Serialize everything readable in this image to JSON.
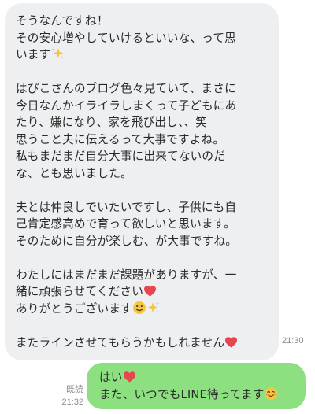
{
  "incoming": {
    "paragraphs": [
      {
        "lines": [
          {
            "text": "そうなんですね！"
          },
          {
            "text": "その安心増やしていけるといいな、って思"
          },
          {
            "text": "います",
            "icon": "sparkles-icon"
          }
        ]
      },
      {
        "lines": [
          {
            "text": "はぴこさんのブログ色々見ていて、まさに"
          },
          {
            "text": "今日なんかイライラしまくって子どもにあ"
          },
          {
            "text": "たり、嫌になり、家を飛び出し、、笑"
          },
          {
            "text": "思うこと夫に伝えるって大事ですよね。"
          },
          {
            "text": "私もまだまだ自分大事に出来てないのだ"
          },
          {
            "text": "な、とも思いました。"
          }
        ]
      },
      {
        "lines": [
          {
            "text": "夫とは仲良しでいたいですし、子供にも自"
          },
          {
            "text": "己肯定感高めで育って欲しいと思います。"
          },
          {
            "text": "そのために自分が楽しむ、が大事ですね。"
          }
        ]
      },
      {
        "lines": [
          {
            "text": "わたしにはまだまだ課題がありますが、一"
          },
          {
            "text": "緒に頑張らせてください",
            "icon": "heart-icon"
          },
          {
            "text": "ありがとうございます",
            "icon": "smiley-sparkles-icon"
          }
        ]
      },
      {
        "lines": [
          {
            "text": "またラインさせてもらうかもしれません",
            "icon": "heart-icon"
          }
        ]
      }
    ],
    "time": "21:30"
  },
  "outgoing": {
    "lines": [
      {
        "text": "はい",
        "icon": "heart-icon"
      },
      {
        "text": "また、いつでもLINE待ってます",
        "icon": "blush-smiley-icon"
      }
    ],
    "read_label": "既読",
    "time": "21:32"
  },
  "colors": {
    "incoming_bubble": "#eeeff1",
    "outgoing_bubble": "#8de07f",
    "heart": "#e8454f",
    "sparkle": "#f3c53a",
    "meta_text": "#8d8d8d"
  }
}
